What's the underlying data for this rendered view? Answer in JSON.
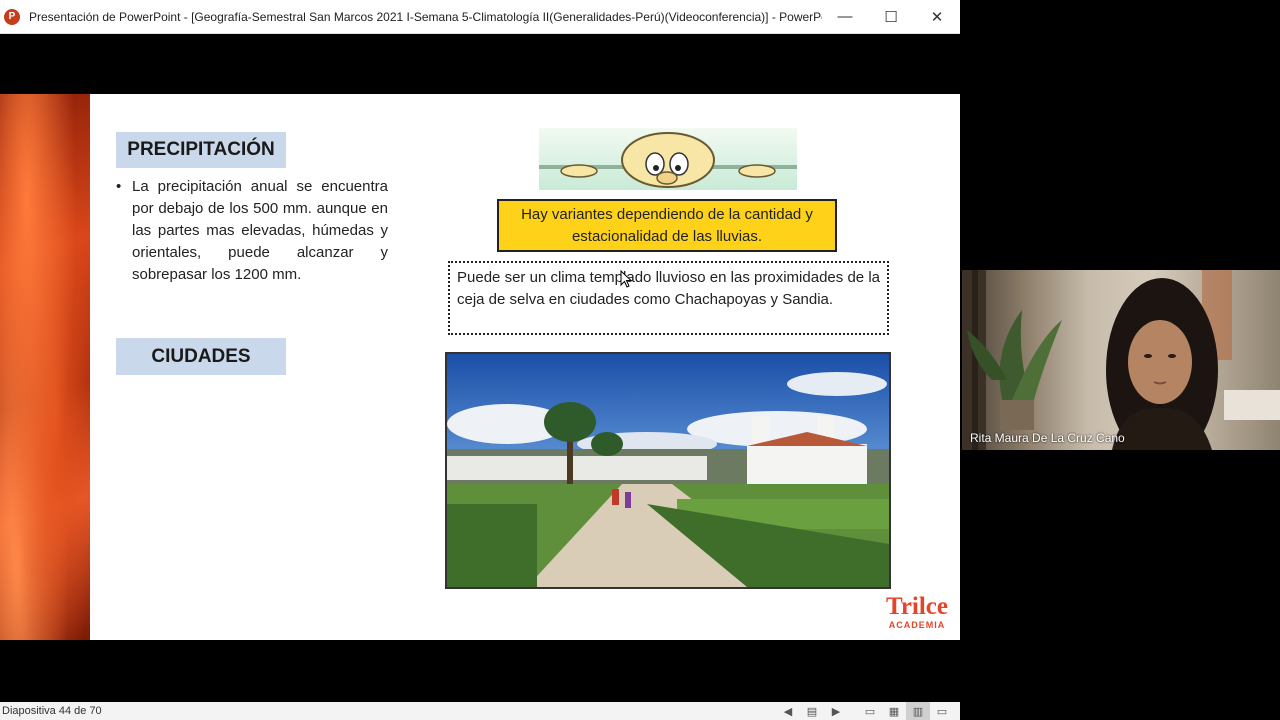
{
  "window": {
    "title": "Presentación de PowerPoint - [Geografía-Semestral San Marcos 2021 I-Semana 5-Climatología II(Generalidades-Perú)(Videoconferencia)] - PowerPoint ...",
    "app_icon_letter": "P",
    "controls": {
      "minimize": "—",
      "maximize": "☐",
      "close": "✕"
    }
  },
  "slide": {
    "tag_precipitacion": "PRECIPITACIÓN",
    "tag_ciudades": "CIUDADES",
    "bullet_marker": "•",
    "bullet_text": "La precipitación anual se encuentra por debajo de los 500 mm. aunque en las partes mas elevadas, húmedas y orientales, puede alcanzar y sobrepasar los 1200 mm.",
    "yellow_box": "Hay variantes dependiendo de la cantidad y estacionalidad de las lluvias.",
    "dotted_box": "Puede ser un clima templado lluvioso en las proximidades de la ceja de selva en ciudades como Chachapoyas y Sandia.",
    "brand_name": "Trilce",
    "brand_sub": "ACADEMIA"
  },
  "video": {
    "participant_name": "Rita Maura De La Cruz Cano"
  },
  "statusbar": {
    "slide_counter": "Diapositiva 44 de 70"
  }
}
